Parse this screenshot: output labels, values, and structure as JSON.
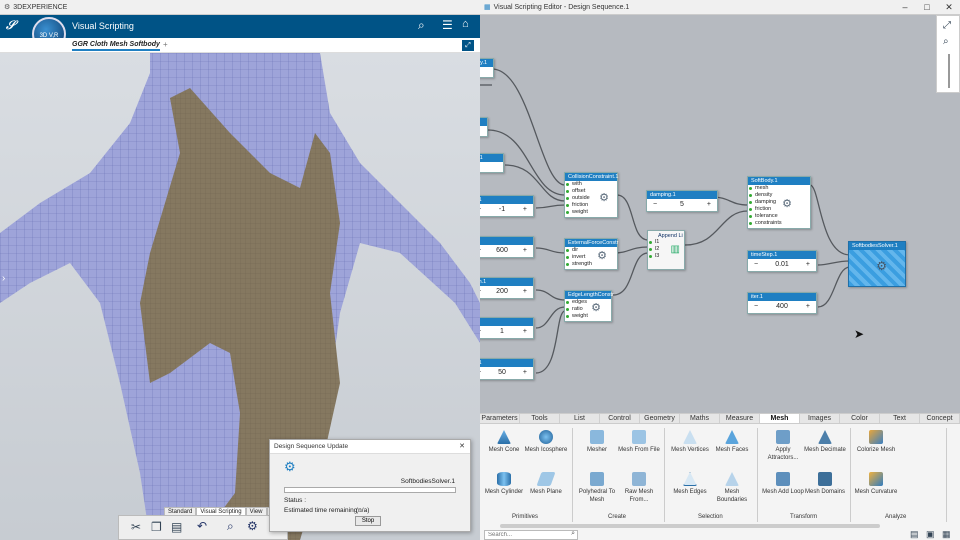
{
  "left_window": {
    "title": "3DEXPERIENCE",
    "app_name": "Visual Scripting",
    "compass_label": "3D V,R",
    "tab_title": "GGR Cloth Mesh Softbody",
    "tab_add": "+",
    "bottom_tabs": [
      "Standard",
      "Visual Scripting",
      "View",
      "AI"
    ]
  },
  "dialog": {
    "title": "Design Sequence Update",
    "close": "✕",
    "item_name": "SoftbodiesSolver.1",
    "progress": 0,
    "status_label": "Status :",
    "time_label": "Estimated time remaining :",
    "time_value": "(n/a)",
    "stop_label": "Stop"
  },
  "right_window": {
    "title": "Visual Scripting Editor - Design Sequence.1"
  },
  "nodes": {
    "collision": {
      "title": "CollisionConstraint.1",
      "ports": [
        "with",
        "offset",
        "outside",
        "friction",
        "weight"
      ]
    },
    "external": {
      "title": "ExternalForceConstr",
      "ports": [
        "dir",
        "invert",
        "strength"
      ]
    },
    "edge": {
      "title": "EdgeLengthConstr",
      "ports": [
        "edges",
        "ratio",
        "weight"
      ]
    },
    "append": {
      "title": "Append Li",
      "ports": [
        "l1",
        "l2",
        "l3"
      ]
    },
    "damping": {
      "title": "damping.1",
      "value": "5"
    },
    "softbody": {
      "title": "SoftBody.1",
      "ports": [
        "mesh",
        "density",
        "damping",
        "friction",
        "tolerance",
        "constraints"
      ]
    },
    "timestep": {
      "title": "timeStep.1",
      "value": "0.01"
    },
    "iter": {
      "title": "iter.1",
      "value": "400"
    },
    "solver": {
      "title": "SoftbodiesSolver.1"
    },
    "partial": [
      {
        "title": "ody.1",
        "value": ""
      },
      {
        "title": "",
        "value": ""
      },
      {
        "title": "in.1",
        "value": ""
      },
      {
        "title": "e.1",
        "value": "-1"
      },
      {
        "title": "t.1",
        "value": "600"
      },
      {
        "title": "gth.1",
        "value": "200"
      },
      {
        "title": ".1",
        "value": "1"
      },
      {
        "title": "e.1",
        "value": "50"
      }
    ]
  },
  "ribbon": {
    "tabs": [
      "Parameters",
      "Tools",
      "List",
      "Control",
      "Geometry",
      "Maths",
      "Measure",
      "Mesh",
      "Images",
      "Color",
      "Text",
      "Concept"
    ],
    "active_tab": "Mesh",
    "tools": [
      "Mesh Cone",
      "Mesh Icosphere",
      "Mesher",
      "Mesh From File",
      "Mesh Vertices",
      "Mesh Faces",
      "Apply Attractors...",
      "Mesh Decimate",
      "Colorize Mesh",
      "Mesh Cylinder",
      "Mesh Plane",
      "Polyhedral To Mesh",
      "Raw Mesh From...",
      "Mesh Edges",
      "Mesh Boundaries",
      "Mesh Add Loop",
      "Mesh Domains",
      "Mesh Curvature"
    ],
    "sections": [
      "Primitives",
      "Create",
      "Selection",
      "Transform",
      "Analyze"
    ],
    "search_placeholder": "Search..."
  },
  "colors": {
    "accent": "#005386",
    "node_header": "#1f7fc2",
    "port": "#33aa33"
  }
}
